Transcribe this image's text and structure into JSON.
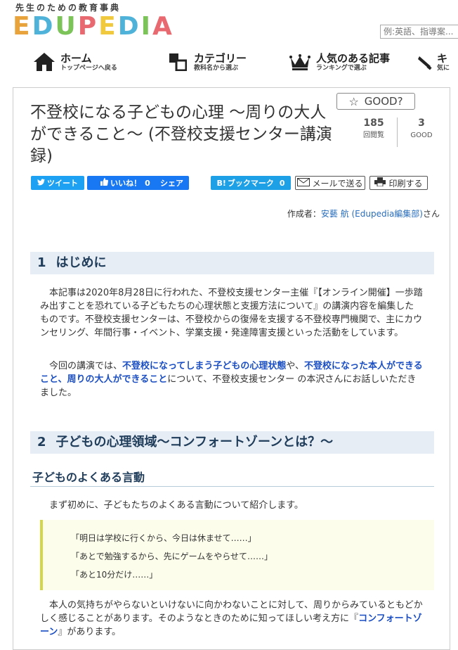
{
  "header": {
    "tagline": "先生のための教育事典",
    "logo_letters": [
      {
        "ch": "E",
        "color": "#e8a33d"
      },
      {
        "ch": "D",
        "color": "#4fb3d9"
      },
      {
        "ch": "U",
        "color": "#7cc35a"
      },
      {
        "ch": "P",
        "color": "#e8696f"
      },
      {
        "ch": "E",
        "color": "#f0c93e"
      },
      {
        "ch": "D",
        "color": "#4fb3d9"
      },
      {
        "ch": "I",
        "color": "#7cc35a"
      },
      {
        "ch": "A",
        "color": "#e8696f"
      }
    ],
    "search_placeholder": "例:英語、指導案..."
  },
  "nav": [
    {
      "title": "ホーム",
      "sub": "トップページへ戻る",
      "icon": "home-icon"
    },
    {
      "title": "カテゴリー",
      "sub": "教科名から選ぶ",
      "icon": "category-icon"
    },
    {
      "title": "人気のある記事",
      "sub": "ランキングで選ぶ",
      "icon": "crown-icon"
    },
    {
      "title": "キ",
      "sub": "気に",
      "icon": "pen-icon"
    }
  ],
  "article": {
    "title": "不登校になる子どもの心理 〜周りの大人ができること〜 (不登校支援センター講演録)",
    "good_label": "GOOD?",
    "stats": [
      {
        "value": "185",
        "label": "回閲覧"
      },
      {
        "value": "3",
        "label": "GOOD"
      }
    ],
    "share": {
      "tweet": "ツイート",
      "like": "いいね！",
      "like_count": "0",
      "share": "シェア",
      "bookmark": "ブックマーク",
      "bookmark_prefix": "B!",
      "bookmark_count": "0",
      "mail": "メールで送る",
      "print": "印刷する"
    },
    "author": {
      "prefix": "作成者：",
      "name": "安藝 航 (Edupedia編集部)",
      "suffix": "さん"
    },
    "section1": {
      "num": "1",
      "title": "はじめに",
      "p1": "本記事は2020年8月28日に行われた、不登校支援センター主催『【オンライン開催】一歩踏み出すことを恐れている子どもたちの心理状態と支援方法について』の講演内容を編集したものです。不登校支援センターは、不登校からの復帰を支援する不登校専門機関で、主にカウンセリング、年間行事・イベント、学業支援・発達障害支援といった活動をしています。",
      "p2_a": "今回の講演では、",
      "p2_b": "不登校になってしまう子どもの心理状態",
      "p2_c": "や、",
      "p2_d": "不登校になった本人ができること、周りの大人ができること",
      "p2_e": "について、不登校支援センター の本沢さんにお話しいただきました。"
    },
    "section2": {
      "num": "2",
      "title": "子どもの心理領域〜コンフォートゾーンとは？〜",
      "subhead": "子どものよくある言動",
      "intro": "まず初めに、子どもたちのよくある言動について紹介します。",
      "quotes": [
        "「明日は学校に行くから、今日は休ませて……」",
        "「あとで勉強するから、先にゲームをやらせて……」",
        "「あと10分だけ……」"
      ],
      "p3_a": "本人の気持ちがやらないといけないに向かわないことに対して、周りからみているともどかしく感じることがあります。そのようなときのために知ってほしい考え方に『",
      "p3_b": "コンフォートゾーン",
      "p3_c": "』があります。"
    }
  }
}
